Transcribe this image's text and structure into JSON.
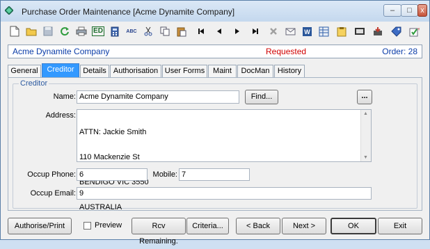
{
  "window": {
    "title": "Purchase Order Maintenance  [Acme Dynamite Company]",
    "min_glyph": "–",
    "max_glyph": "□",
    "close_glyph": "x"
  },
  "toolbar": {
    "icons": [
      "new-document-icon",
      "open-folder-icon",
      "save-icon",
      "refresh-icon",
      "print-icon",
      "edi-icon",
      "calculator-icon",
      "spellcheck-icon",
      "cut-icon",
      "copy-icon",
      "paste-icon",
      "first-record-icon",
      "previous-record-icon",
      "next-record-icon",
      "last-record-icon",
      "delete-icon",
      "email-icon",
      "word-icon",
      "excel-icon",
      "notes-icon",
      "film-icon",
      "inbox-icon",
      "tag-icon",
      "approve-icon"
    ],
    "edi_text": "ED",
    "abc_text": "ABC"
  },
  "info": {
    "company": "Acme Dynamite Company",
    "status": "Requested",
    "order": "Order: 28",
    "company_color": "#0a3ca8",
    "status_color": "#d00000"
  },
  "tabs": [
    "General",
    "Creditor",
    "Details",
    "Authorisation",
    "User Forms",
    "Maint",
    "DocMan",
    "History"
  ],
  "active_tab": "Creditor",
  "creditor": {
    "group_title": "Creditor",
    "name_label": "Name:",
    "name_value": "Acme Dynamite Company",
    "find_button": "Find...",
    "more_button": "...",
    "address_label": "Address:",
    "address_lines": [
      "ATTN: Jackie Smith",
      "110 Mackenzie St",
      "BENDIGO VIC 3550",
      "AUSTRALIA"
    ],
    "occup_phone_label": "Occup Phone:",
    "occup_phone_value": "6",
    "mobile_label": "Mobile:",
    "mobile_value": "7",
    "occup_email_label": "Occup Email:",
    "occup_email_value": "9"
  },
  "bottom": {
    "authorise_print": "Authorise/Print",
    "preview": "Preview",
    "rcv_remaining": "Rcv Remaining.",
    "criteria": "Criteria...",
    "back": "< Back",
    "next": "Next >",
    "ok": "OK",
    "exit": "Exit"
  }
}
